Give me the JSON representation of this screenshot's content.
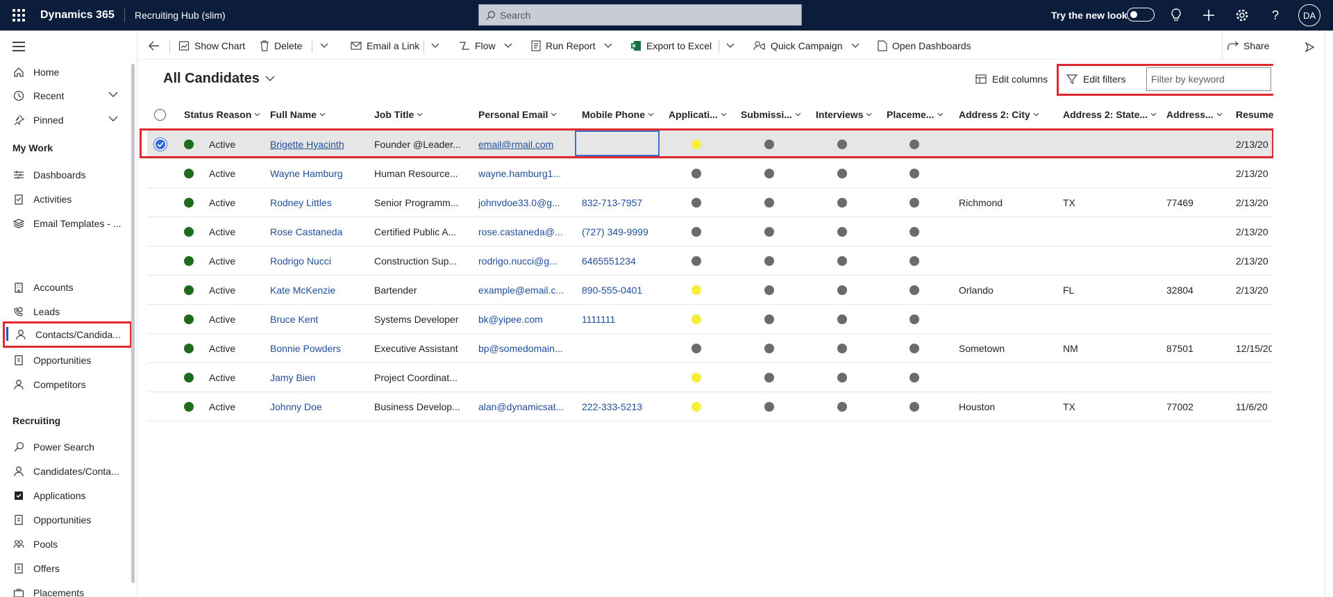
{
  "topbar": {
    "app_name": "Dynamics 365",
    "module_name": "Recruiting Hub (slim)",
    "search_placeholder": "Search",
    "try_new_look": "Try the new look",
    "avatar": "DA"
  },
  "sidebar": {
    "items_top": [
      {
        "label": "Home",
        "icon": "home-icon"
      },
      {
        "label": "Recent",
        "icon": "clock-icon"
      },
      {
        "label": "Pinned",
        "icon": "pin-icon"
      }
    ],
    "my_work_header": "My Work",
    "my_work": [
      {
        "label": "Dashboards",
        "icon": "dashboard-icon"
      },
      {
        "label": "Activities",
        "icon": "clipboard-icon"
      },
      {
        "label": "Email Templates - ...",
        "icon": "layers-icon"
      }
    ],
    "sales": [
      {
        "label": "Accounts",
        "icon": "building-icon"
      },
      {
        "label": "Leads",
        "icon": "phone-person-icon"
      },
      {
        "label": "Contacts/Candida...",
        "icon": "person-icon"
      },
      {
        "label": "Opportunities",
        "icon": "document-icon"
      },
      {
        "label": "Competitors",
        "icon": "person-icon"
      }
    ],
    "recruiting_header": "Recruiting",
    "recruiting": [
      {
        "label": "Power Search",
        "icon": "search-icon"
      },
      {
        "label": "Candidates/Conta...",
        "icon": "person-icon"
      },
      {
        "label": "Applications",
        "icon": "checkbox-icon"
      },
      {
        "label": "Opportunities",
        "icon": "document-icon"
      },
      {
        "label": "Pools",
        "icon": "group-icon"
      },
      {
        "label": "Offers",
        "icon": "document-icon"
      },
      {
        "label": "Placements",
        "icon": "briefcase-icon"
      }
    ]
  },
  "commands": {
    "show_chart": "Show Chart",
    "delete": "Delete",
    "email_link": "Email a Link",
    "flow": "Flow",
    "run_report": "Run Report",
    "export_excel": "Export to Excel",
    "quick_campaign": "Quick Campaign",
    "open_dashboards": "Open Dashboards",
    "share": "Share"
  },
  "view": {
    "title": "All Candidates",
    "edit_columns": "Edit columns",
    "edit_filters": "Edit filters",
    "keyword_placeholder": "Filter by keyword"
  },
  "columns": [
    "Status Reason",
    "Full Name",
    "Job Title",
    "Personal Email",
    "Mobile Phone",
    "Applicati...",
    "Submissi...",
    "Interviews",
    "Placeme...",
    "Address 2: City",
    "Address 2: State...",
    "Address...",
    "Resume"
  ],
  "rows": [
    {
      "status": "Active",
      "name": "Brigette Hyacinth",
      "job": "Founder @Leader...",
      "email": "email@rmail.com",
      "phone": "",
      "app": "yellow",
      "city": "",
      "state": "",
      "zip": "",
      "resume": "2/13/20"
    },
    {
      "status": "Active",
      "name": "Wayne Hamburg",
      "job": "Human Resource...",
      "email": "wayne.hamburg1...",
      "phone": "",
      "app": "gray",
      "city": "",
      "state": "",
      "zip": "",
      "resume": "2/13/20"
    },
    {
      "status": "Active",
      "name": "Rodney Littles",
      "job": "Senior Programm...",
      "email": "johnvdoe33.0@g...",
      "phone": "832-713-7957",
      "app": "gray",
      "city": "Richmond",
      "state": "TX",
      "zip": "77469",
      "resume": "2/13/20"
    },
    {
      "status": "Active",
      "name": "Rose Castaneda",
      "job": "Certified Public A...",
      "email": "rose.castaneda@...",
      "phone": "(727) 349-9999",
      "app": "gray",
      "city": "",
      "state": "",
      "zip": "",
      "resume": "2/13/20"
    },
    {
      "status": "Active",
      "name": "Rodrigo Nucci",
      "job": "Construction Sup...",
      "email": "rodrigo.nucci@g...",
      "phone": "6465551234",
      "app": "gray",
      "city": "",
      "state": "",
      "zip": "",
      "resume": "2/13/20"
    },
    {
      "status": "Active",
      "name": "Kate McKenzie",
      "job": "Bartender",
      "email": "example@email.c...",
      "phone": "890-555-0401",
      "app": "yellow",
      "city": "Orlando",
      "state": "FL",
      "zip": "32804",
      "resume": "2/13/20"
    },
    {
      "status": "Active",
      "name": "Bruce Kent",
      "job": "Systems Developer",
      "email": "bk@yipee.com",
      "phone": "1111111",
      "app": "yellow",
      "city": "",
      "state": "",
      "zip": "",
      "resume": ""
    },
    {
      "status": "Active",
      "name": "Bonnie Powders",
      "job": "Executive Assistant",
      "email": "bp@somedomain...",
      "phone": "",
      "app": "gray",
      "city": "Sometown",
      "state": "NM",
      "zip": "87501",
      "resume": "12/15/20"
    },
    {
      "status": "Active",
      "name": "Jamy Bien",
      "job": "Project Coordinat...",
      "email": "",
      "phone": "",
      "app": "yellow",
      "city": "",
      "state": "",
      "zip": "",
      "resume": ""
    },
    {
      "status": "Active",
      "name": "Johnny Doe",
      "job": "Business Develop...",
      "email": "alan@dynamicsat...",
      "phone": "222-333-5213",
      "app": "yellow",
      "city": "Houston",
      "state": "TX",
      "zip": "77002",
      "resume": "11/6/20"
    }
  ],
  "colors": {
    "topbar": "#0b1d3b",
    "highlight": "#e0282e",
    "status_active": "#1e6b1e",
    "indicator_yellow": "#f5ee3a",
    "indicator_gray": "#6b6b6b",
    "link": "#1f4e99"
  }
}
